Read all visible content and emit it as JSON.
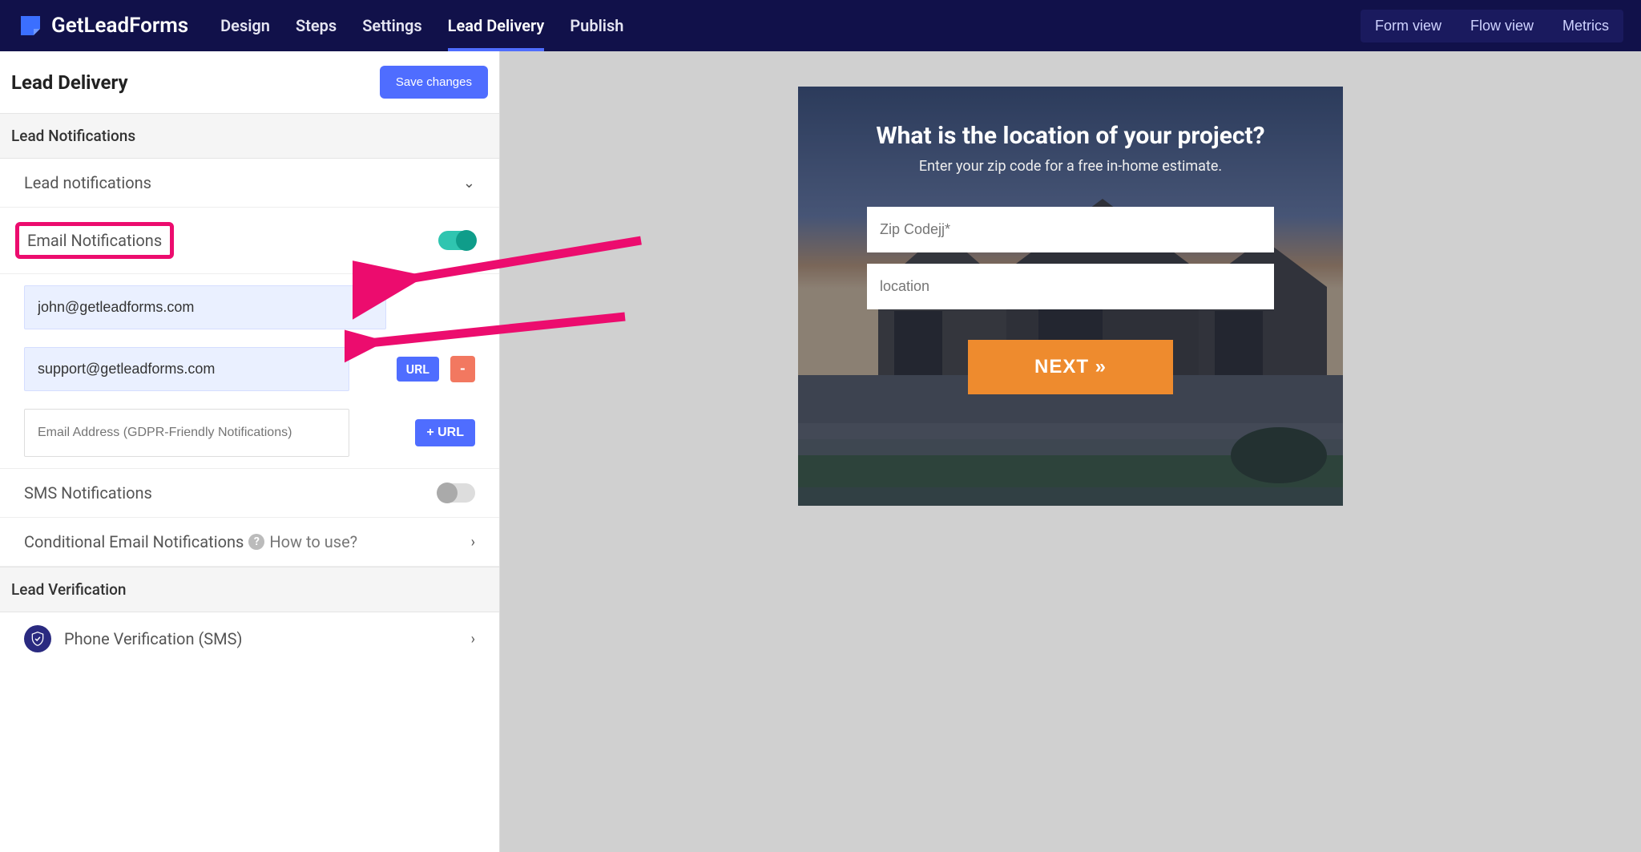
{
  "brand": {
    "name": "GetLeadForms"
  },
  "nav": {
    "tabs": [
      {
        "label": "Design",
        "active": false
      },
      {
        "label": "Steps",
        "active": false
      },
      {
        "label": "Settings",
        "active": false
      },
      {
        "label": "Lead Delivery",
        "active": true
      },
      {
        "label": "Publish",
        "active": false
      }
    ],
    "views": {
      "form": "Form view",
      "flow": "Flow view",
      "metrics": "Metrics"
    }
  },
  "page": {
    "title": "Lead Delivery",
    "save_label": "Save changes"
  },
  "sections": {
    "lead_notifications_group": "Lead Notifications",
    "lead_notifications_row": "Lead notifications",
    "email_notifications_row": "Email Notifications",
    "sms_notifications_row": "SMS Notifications",
    "conditional_row": "Conditional Email Notifications",
    "conditional_help": "How to use?",
    "lead_verification_group": "Lead Verification",
    "phone_verification_row": "Phone Verification (SMS)"
  },
  "emails": {
    "entry1": "john@getleadforms.com",
    "entry2": "support@getleadforms.com",
    "placeholder_new": "Email Address (GDPR-Friendly Notifications)",
    "url_label": "URL",
    "remove_label": "-",
    "add_url_label": "+ URL"
  },
  "preview_form": {
    "title": "What is the location of your project?",
    "subtitle": "Enter your zip code for a free in-home estimate.",
    "zip_placeholder": "Zip Codejj*",
    "location_placeholder": "location",
    "next_label": "NEXT »"
  },
  "colors": {
    "navy": "#11114a",
    "primary_blue": "#4f6dff",
    "teal": "#0f9d8a",
    "orange": "#ee8b2e",
    "pink": "#ec0c6e"
  }
}
